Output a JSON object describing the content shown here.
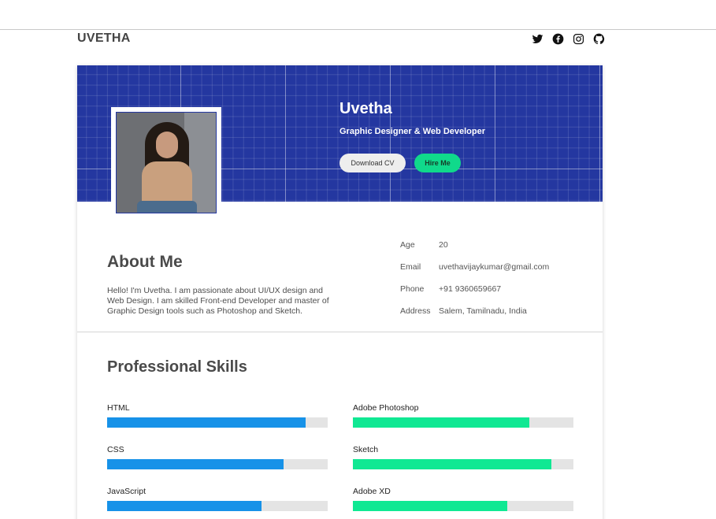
{
  "brand": "UVETHA",
  "social": [
    {
      "icon": "twitter-icon"
    },
    {
      "icon": "facebook-icon"
    },
    {
      "icon": "instagram-icon"
    },
    {
      "icon": "github-icon"
    }
  ],
  "hero": {
    "name": "Uvetha",
    "title": "Graphic Designer & Web Developer",
    "download_cv": "Download CV",
    "hire_me": "Hire Me"
  },
  "about": {
    "title": "About Me",
    "text": "Hello! I'm Uvetha. I am passionate about UI/UX design and Web Design. I am skilled Front-end Developer and master of Graphic Design tools such as Photoshop and Sketch.",
    "info": [
      {
        "label": "Age",
        "value": "20"
      },
      {
        "label": "Email",
        "value": "uvethavijaykumar@gmail.com"
      },
      {
        "label": "Phone",
        "value": "+91 9360659667"
      },
      {
        "label": "Address",
        "value": "Salem, Tamilnadu, India"
      }
    ]
  },
  "skills": {
    "title": "Professional Skills",
    "left": [
      {
        "name": "HTML",
        "level": 0.9
      },
      {
        "name": "CSS",
        "level": 0.8
      },
      {
        "name": "JavaScript",
        "level": 0.7
      }
    ],
    "right": [
      {
        "name": "Adobe Photoshop",
        "level": 0.8
      },
      {
        "name": "Sketch",
        "level": 0.9
      },
      {
        "name": "Adobe XD",
        "level": 0.7
      }
    ]
  },
  "colors": {
    "hero_bg": "#2437a0",
    "accent_green": "#10d98b",
    "bar_blue": "#1792e8",
    "bar_green": "#10e893"
  }
}
